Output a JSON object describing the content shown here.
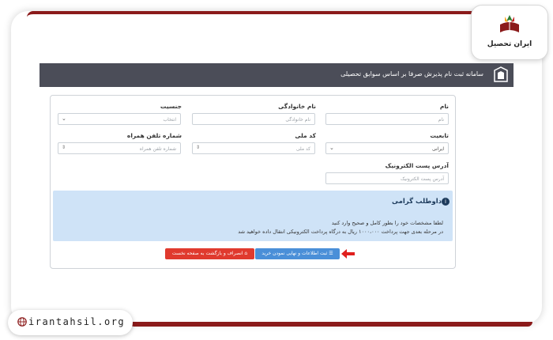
{
  "brand": {
    "logo_text": "ایران تحصیل",
    "website": "irantahsil.org"
  },
  "header": {
    "title": "سامانه ثبت نام پذیرش صرفا بر اساس سوابق تحصیلی"
  },
  "form": {
    "first_name": {
      "label": "نام",
      "placeholder": "نام"
    },
    "last_name": {
      "label": "نام خانوادگی",
      "placeholder": "نام خانوادگی"
    },
    "gender": {
      "label": "جنسیت",
      "value": "انتخاب"
    },
    "nationality": {
      "label": "تابعیت",
      "value": "ایرانی"
    },
    "national_code": {
      "label": "کد ملی",
      "placeholder": "کد ملی"
    },
    "mobile": {
      "label": "شماره تلفن همراه",
      "placeholder": "شماره تلفن همراه"
    },
    "email": {
      "label": "آدرس پست الکترونیک",
      "placeholder": "آدرس پست الکترونیک"
    }
  },
  "notice": {
    "title": "داوطلب گرامی",
    "line1": "لطفا مشخصات خود را بطور کامل و صحیح وارد کنید",
    "line2": "در مرحله بعدی جهت پرداخت ۱۰۰۰،۰۰۰ ریال به درگاه پرداخت الکترونیکی انتقال داده خواهید شد"
  },
  "actions": {
    "submit_label": "ثبت اطلاعات و نهایی نمودن خرید",
    "cancel_label": "انصراف و بازگشت به صفحه نخست"
  },
  "colors": {
    "accent_red": "#8b1a1a",
    "header_bg": "#4b4d58",
    "submit_blue": "#4a8fd8",
    "cancel_red": "#e03a2e",
    "notice_bg": "#cfe3f7"
  }
}
